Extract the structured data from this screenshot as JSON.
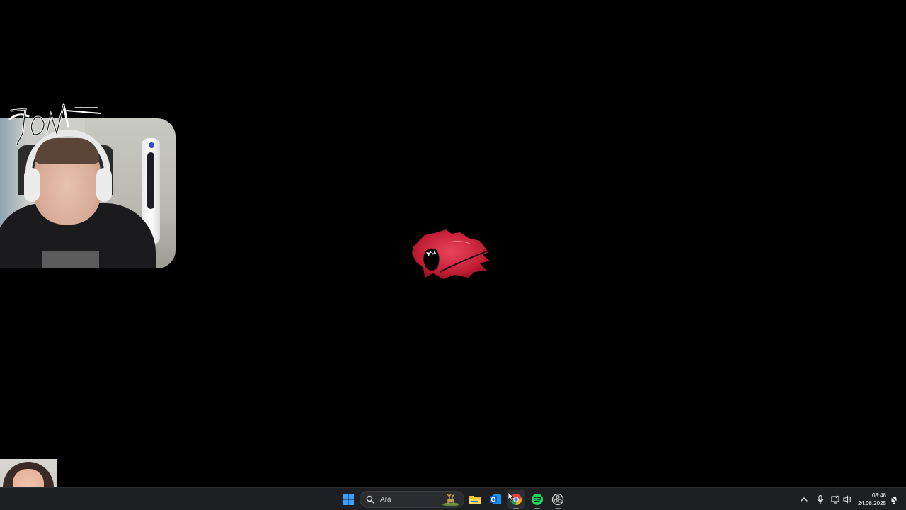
{
  "taskbar": {
    "search_label": "Ara",
    "apps": [
      {
        "name": "start",
        "icon": "windows-icon"
      },
      {
        "name": "file-explorer",
        "icon": "folder-icon"
      },
      {
        "name": "outlook",
        "icon": "outlook-icon"
      },
      {
        "name": "chrome",
        "icon": "chrome-icon"
      },
      {
        "name": "spotify",
        "icon": "spotify-icon"
      },
      {
        "name": "obs",
        "icon": "obs-icon"
      }
    ]
  },
  "tray": {
    "time": "08:48",
    "date": "24.08.2025"
  },
  "overlay": {
    "signature_icon": "signature-logo-icon",
    "center_logo_icon": "panther-logo-icon"
  },
  "colors": {
    "desktop_bg": "#000000",
    "taskbar_bg": "#1e1f22",
    "logo_red": "#d4283c",
    "spotify_green": "#1ed760",
    "explorer_yellow": "#f5c12e",
    "outlook_blue": "#0a64c8"
  }
}
